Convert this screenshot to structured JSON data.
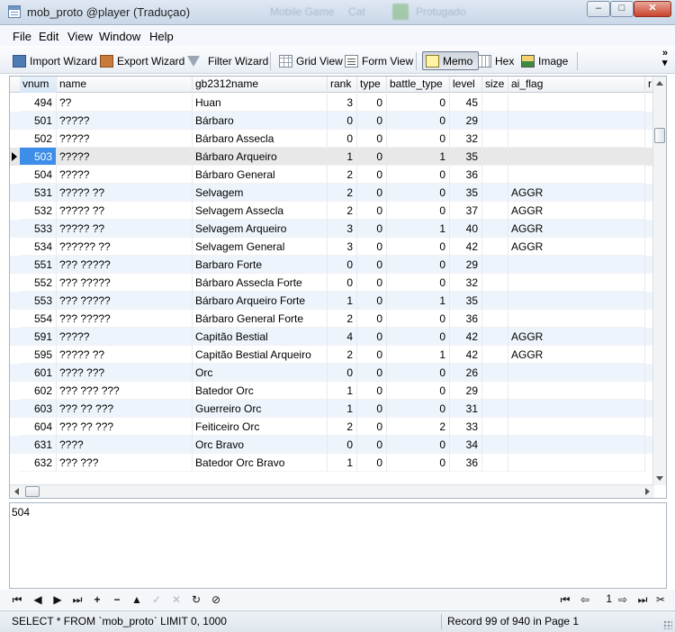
{
  "window": {
    "title": "mob_proto @player (Traduçao)",
    "ghost_text": [
      "Mobile Game",
      "Cat",
      "Protugado"
    ],
    "buttons": {
      "minimize": "–",
      "maximize": "□",
      "close": "✕"
    }
  },
  "menu": [
    "File",
    "Edit",
    "View",
    "Window",
    "Help"
  ],
  "toolbar": {
    "import_wizard": "Import Wizard",
    "export_wizard": "Export Wizard",
    "filter_wizard": "Filter Wizard",
    "grid_view": "Grid View",
    "form_view": "Form View",
    "memo": "Memo",
    "hex": "Hex",
    "image": "Image",
    "more": "»"
  },
  "grid": {
    "columns": [
      "vnum",
      "name",
      "gb2312name",
      "rank",
      "type",
      "battle_type",
      "level",
      "size",
      "ai_flag",
      "r"
    ],
    "sorted_column": "vnum",
    "current_row": 3,
    "rows": [
      [
        "494",
        "??",
        "Huan",
        "3",
        "0",
        "0",
        "45",
        "",
        ""
      ],
      [
        "501",
        "?????",
        "Bárbaro",
        "0",
        "0",
        "0",
        "29",
        "",
        ""
      ],
      [
        "502",
        "?????",
        "Bárbaro Assecla",
        "0",
        "0",
        "0",
        "32",
        "",
        ""
      ],
      [
        "503",
        "?????",
        "Bárbaro Arqueiro",
        "1",
        "0",
        "1",
        "35",
        "",
        ""
      ],
      [
        "504",
        "?????",
        "Bárbaro General",
        "2",
        "0",
        "0",
        "36",
        "",
        ""
      ],
      [
        "531",
        "????? ??",
        "Selvagem",
        "2",
        "0",
        "0",
        "35",
        "",
        "AGGR"
      ],
      [
        "532",
        "????? ??",
        "Selvagem Assecla",
        "2",
        "0",
        "0",
        "37",
        "",
        "AGGR"
      ],
      [
        "533",
        "????? ??",
        "Selvagem Arqueiro",
        "3",
        "0",
        "1",
        "40",
        "",
        "AGGR"
      ],
      [
        "534",
        "?????? ??",
        "Selvagem General",
        "3",
        "0",
        "0",
        "42",
        "",
        "AGGR"
      ],
      [
        "551",
        "??? ?????",
        "Barbaro  Forte",
        "0",
        "0",
        "0",
        "29",
        "",
        ""
      ],
      [
        "552",
        "??? ?????",
        "Bárbaro Assecla Forte",
        "0",
        "0",
        "0",
        "32",
        "",
        ""
      ],
      [
        "553",
        "??? ?????",
        "Bárbaro Arqueiro Forte",
        "1",
        "0",
        "1",
        "35",
        "",
        ""
      ],
      [
        "554",
        "??? ?????",
        "Bárbaro General Forte",
        "2",
        "0",
        "0",
        "36",
        "",
        ""
      ],
      [
        "591",
        "?????",
        "Capitão Bestial",
        "4",
        "0",
        "0",
        "42",
        "",
        "AGGR"
      ],
      [
        "595",
        "????? ??",
        "Capitão Bestial Arqueiro",
        "2",
        "0",
        "1",
        "42",
        "",
        "AGGR"
      ],
      [
        "601",
        "???? ???",
        "Orc",
        "0",
        "0",
        "0",
        "26",
        "",
        ""
      ],
      [
        "602",
        "??? ??? ???",
        "Batedor Orc",
        "1",
        "0",
        "0",
        "29",
        "",
        ""
      ],
      [
        "603",
        "??? ?? ???",
        "Guerreiro Orc",
        "1",
        "0",
        "0",
        "31",
        "",
        ""
      ],
      [
        "604",
        "??? ?? ???",
        "Feiticeiro Orc",
        "2",
        "0",
        "2",
        "33",
        "",
        ""
      ],
      [
        "631",
        "????",
        "Orc Bravo",
        "0",
        "0",
        "0",
        "34",
        "",
        ""
      ],
      [
        "632",
        "??? ???",
        "Batedor Orc Bravo",
        "1",
        "0",
        "0",
        "36",
        "",
        ""
      ]
    ]
  },
  "memo_text": "504",
  "navigator": {
    "buttons": [
      "first-record",
      "prior-record",
      "next-record",
      "last-record",
      "insert-record",
      "delete-record",
      "post-edit",
      "cancel-edit",
      "refresh",
      "stop"
    ],
    "page": "1"
  },
  "status": {
    "sql": "SELECT * FROM `mob_proto` LIMIT 0, 1000",
    "record_info": "Record 99 of 940 in Page 1"
  }
}
